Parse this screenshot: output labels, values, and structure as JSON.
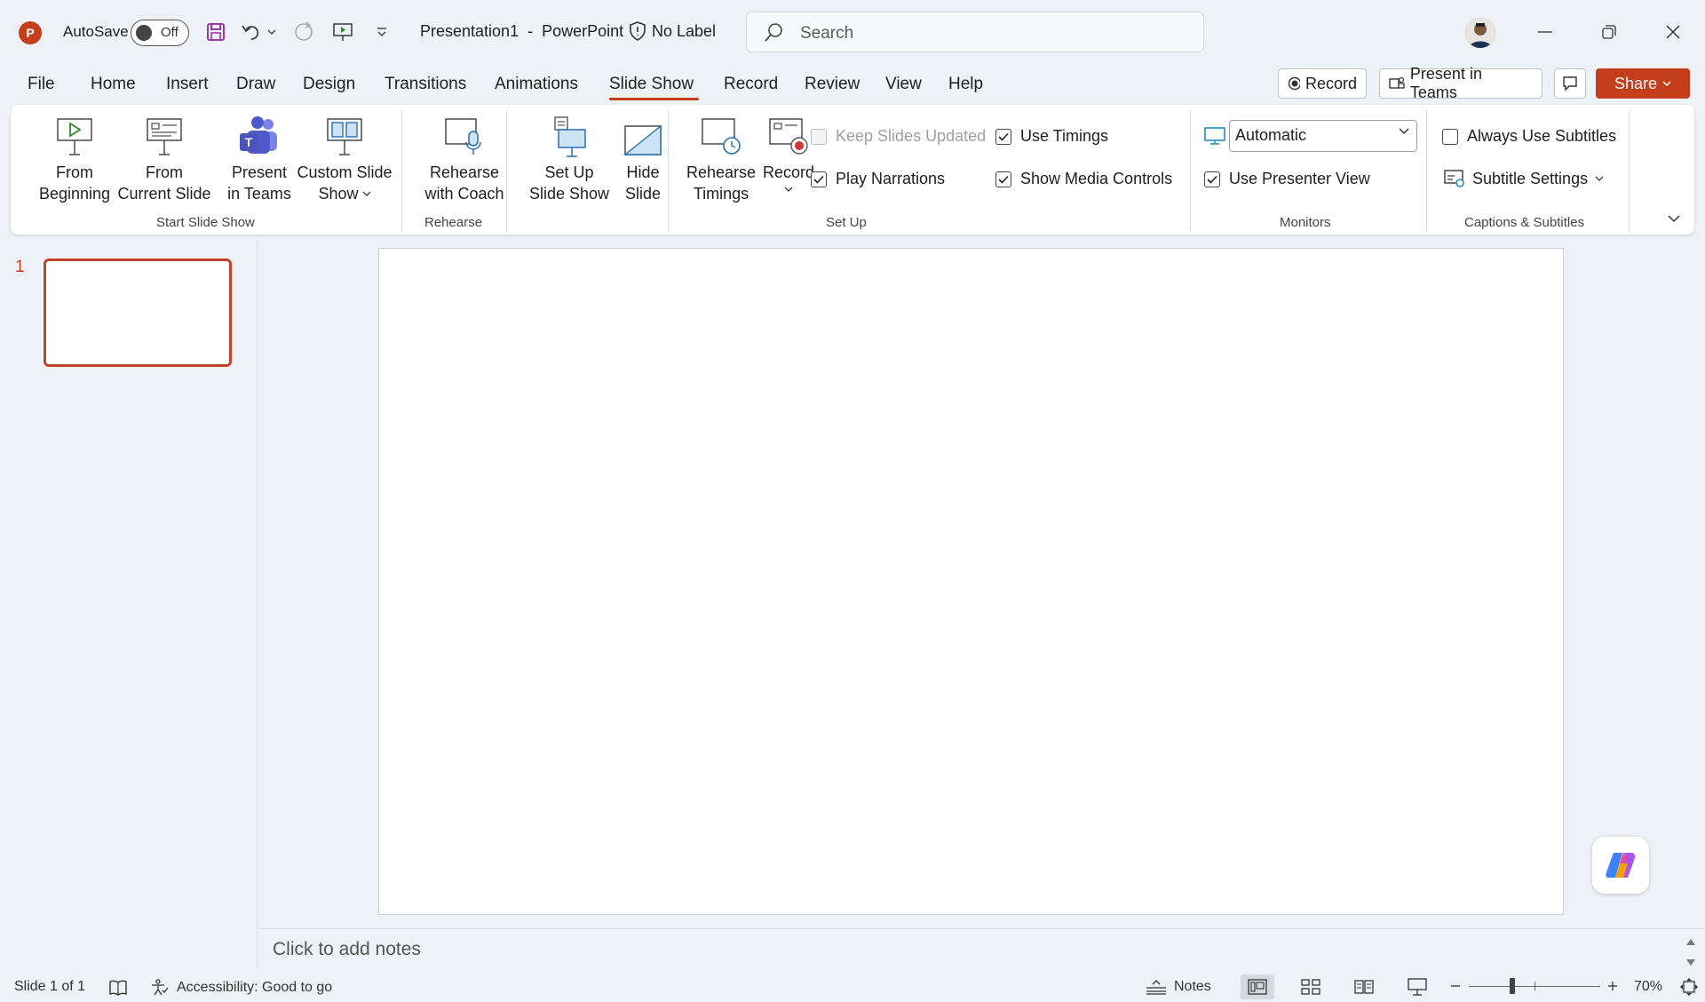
{
  "titlebar": {
    "app_logo": "P",
    "autosave_label": "AutoSave",
    "autosave_state": "Off",
    "doc_title": "Presentation1  -  PowerPoint",
    "sensitivity_label": "No Label",
    "search_placeholder": "Search"
  },
  "menu": {
    "tabs": [
      "File",
      "Home",
      "Insert",
      "Draw",
      "Design",
      "Transitions",
      "Animations",
      "Slide Show",
      "Record",
      "Review",
      "View",
      "Help"
    ],
    "active_tab": "Slide Show",
    "record_button": "Record",
    "present_teams_button": "Present in Teams",
    "share_button": "Share"
  },
  "ribbon": {
    "from_beginning": [
      "From",
      "Beginning"
    ],
    "from_current": [
      "From",
      "Current Slide"
    ],
    "present_in_teams": [
      "Present",
      "in Teams"
    ],
    "custom_show": [
      "Custom Slide",
      "Show"
    ],
    "rehearse_coach": [
      "Rehearse",
      "with Coach"
    ],
    "setup_show": [
      "Set Up",
      "Slide Show"
    ],
    "hide_slide": [
      "Hide",
      "Slide"
    ],
    "rehearse_timings": [
      "Rehearse",
      "Timings"
    ],
    "record": "Record",
    "keep_updated": "Keep Slides Updated",
    "play_narrations": "Play Narrations",
    "use_timings": "Use Timings",
    "show_media": "Show Media Controls",
    "monitor_value": "Automatic",
    "use_presenter_view": "Use Presenter View",
    "always_subtitles": "Always Use Subtitles",
    "subtitle_settings": "Subtitle Settings",
    "groups": {
      "start": "Start Slide Show",
      "rehearse": "Rehearse",
      "setup": "Set Up",
      "monitors": "Monitors",
      "captions": "Captions & Subtitles"
    }
  },
  "slides": {
    "number": "1"
  },
  "notes": {
    "placeholder": "Click to add notes"
  },
  "statusbar": {
    "slide_info": "Slide 1 of 1",
    "accessibility": "Accessibility: Good to go",
    "notes_label": "Notes",
    "zoom": "70%"
  },
  "colors": {
    "accent": "#c43e1c",
    "background": "#eef1f5"
  }
}
